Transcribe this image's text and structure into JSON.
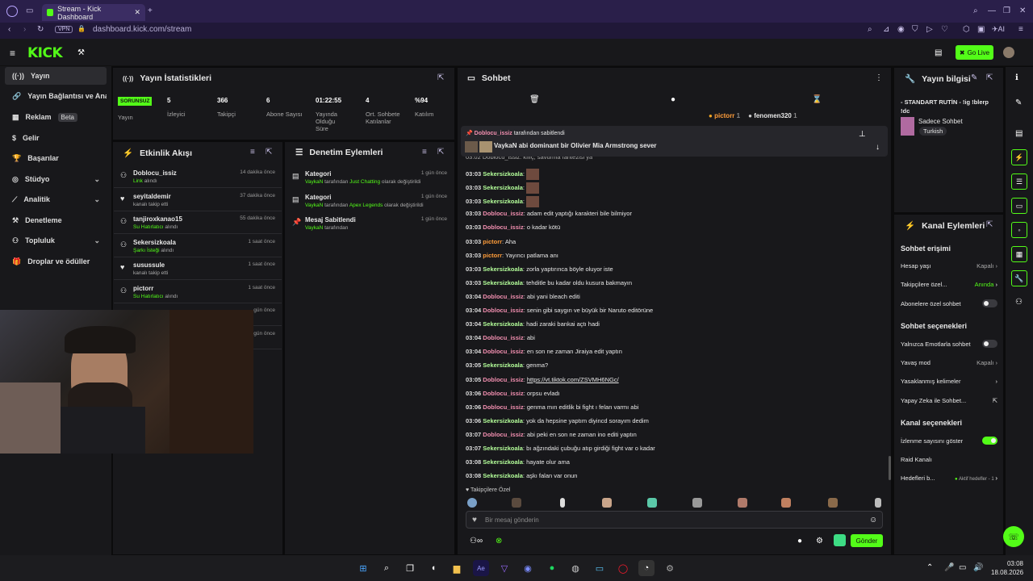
{
  "browser": {
    "tab_title": "Stream - Kick Dashboard",
    "url": "dashboard.kick.com/stream",
    "vpn": "VPN",
    "ai_label": "AI"
  },
  "topnav": {
    "logo": "KICK",
    "go_live": "Go Live"
  },
  "sidebar": {
    "items": [
      {
        "label": "Yayın",
        "icon": "broadcast-icon"
      },
      {
        "label": "Yayın Bağlantısı ve Anahtarı",
        "icon": "link-icon"
      },
      {
        "label": "Reklam",
        "icon": "ad-icon",
        "badge": "Beta"
      },
      {
        "label": "Gelir",
        "icon": "money-icon"
      },
      {
        "label": "Başarılar",
        "icon": "trophy-icon"
      },
      {
        "label": "Stüdyo",
        "icon": "studio-icon"
      },
      {
        "label": "Analitik",
        "icon": "analytics-icon"
      },
      {
        "label": "Denetleme",
        "icon": "hammer-icon"
      },
      {
        "label": "Topluluk",
        "icon": "community-icon"
      },
      {
        "label": "Droplar ve ödüller",
        "icon": "gift-icon"
      }
    ]
  },
  "stats": {
    "title": "Yayın İstatistikleri",
    "status": "SORUNSUZ",
    "status_label": "Yayın",
    "items": [
      {
        "value": "5",
        "label": "İzleyici"
      },
      {
        "value": "366",
        "label": "Takipçi"
      },
      {
        "value": "6",
        "label": "Abone Sayısı"
      },
      {
        "value": "01:22:55",
        "label": "Yayında Olduğu Süre"
      },
      {
        "value": "4",
        "label": "Ort. Sohbete Katılanlar"
      },
      {
        "value": "%94",
        "label": "Katılım"
      }
    ]
  },
  "activity": {
    "title": "Etkinlik Akışı",
    "rows": [
      {
        "name": "Doblocu_issiz",
        "hl": "Link",
        "desc": " alındı",
        "time": "14 dakika önce",
        "icon": "gift-icon"
      },
      {
        "name": "seyitaldemir",
        "hl": "",
        "desc": "kanalı takip etti",
        "time": "37 dakika önce",
        "icon": "heart-icon"
      },
      {
        "name": "tanjiroxkanao15",
        "hl": "Su Hatırlatıcı",
        "desc": " alındı",
        "time": "55 dakika önce",
        "icon": "gift-icon"
      },
      {
        "name": "Sekersizkoala",
        "hl": "Şarkı İsteği",
        "desc": " alındı",
        "time": "1 saat önce",
        "icon": "gift-icon"
      },
      {
        "name": "susussule",
        "hl": "",
        "desc": "kanalı takip etti",
        "time": "1 saat önce",
        "icon": "heart-icon"
      },
      {
        "name": "pictorr",
        "hl": "Su Hatırlatıcı",
        "desc": " alındı",
        "time": "1 saat önce",
        "icon": "gift-icon"
      },
      {
        "name": "",
        "hl": "",
        "desc": "",
        "time": "gün önce",
        "icon": ""
      },
      {
        "name": "",
        "hl": "",
        "desc": "",
        "time": "gün önce",
        "icon": ""
      }
    ]
  },
  "moderation": {
    "title": "Denetim Eylemleri",
    "rows": [
      {
        "name": "Kategori",
        "user": "VaykaN",
        "mid": " tarafından ",
        "hl": "Just Chatting",
        "end": " olarak değiştirildi",
        "time": "1 gün önce"
      },
      {
        "name": "Kategori",
        "user": "VaykaN",
        "mid": " tarafından ",
        "hl": "Apex Legends",
        "end": " olarak değiştirildi",
        "time": "1 gün önce"
      },
      {
        "name": "Mesaj Sabitlendi",
        "user": "VaykaN",
        "mid": " tarafından",
        "hl": "",
        "end": "",
        "time": "1 gün önce"
      }
    ]
  },
  "chat": {
    "title": "Sohbet",
    "top_users": [
      {
        "name": "pictorr",
        "count": "1"
      },
      {
        "name": "fenomen320",
        "count": "1"
      }
    ],
    "pinned_by": "Doblocu_issiz",
    "pinned_label": " tarafından sabitlendi",
    "pinned_message": "VaykaN abi dominant bir Olivier Mia Armstrong sever",
    "partial_line": "03:02 Doblocu_issiz: kılıç, savurma fantezisi ya",
    "messages": [
      {
        "time": "03:03",
        "user": "Sekersizkoala",
        "text": "",
        "emote": true,
        "c": "sek"
      },
      {
        "time": "03:03",
        "user": "Sekersizkoala",
        "text": "",
        "emote": true,
        "c": "sek"
      },
      {
        "time": "03:03",
        "user": "Sekersizkoala",
        "text": "",
        "emote": true,
        "c": "sek"
      },
      {
        "time": "03:03",
        "user": "Doblocu_issiz",
        "text": "adam edit yaptığı karakteri bile bilmiyor",
        "c": "dob"
      },
      {
        "time": "03:03",
        "user": "Doblocu_issiz",
        "text": "o kadar kötü",
        "c": "dob"
      },
      {
        "time": "03:03",
        "user": "pictorr",
        "text": "Aha",
        "c": "pic"
      },
      {
        "time": "03:03",
        "user": "pictorr",
        "text": "Yayıncı patlama anı",
        "c": "pic"
      },
      {
        "time": "03:03",
        "user": "Sekersizkoala",
        "text": "zorla yaptırınca böyle oluyor iste",
        "c": "sek"
      },
      {
        "time": "03:03",
        "user": "Sekersizkoala",
        "text": "tehditle bu kadar oldu kusura bakmayın",
        "c": "sek"
      },
      {
        "time": "03:04",
        "user": "Doblocu_issiz",
        "text": "abi yani bleach editi",
        "c": "dob"
      },
      {
        "time": "03:04",
        "user": "Doblocu_issiz",
        "text": "senin gibi saygın ve büyük bir Naruto editörüne",
        "c": "dob"
      },
      {
        "time": "03:04",
        "user": "Sekersizkoala",
        "text": "hadi zaraki bankai açtı hadi",
        "c": "sek"
      },
      {
        "time": "03:04",
        "user": "Doblocu_issiz",
        "text": "abi",
        "c": "dob"
      },
      {
        "time": "03:04",
        "user": "Doblocu_issiz",
        "text": "en son ne zaman Jiraiya edit yaptın",
        "c": "dob"
      },
      {
        "time": "03:05",
        "user": "Sekersizkoala",
        "text": "genma?",
        "c": "sek"
      },
      {
        "time": "03:05",
        "user": "Doblocu_issiz",
        "text": "https://vt.tiktok.com/ZSVMH6NGc/",
        "c": "dob",
        "link": true
      },
      {
        "time": "03:06",
        "user": "Doblocu_issiz",
        "text": "orpsu evladı",
        "c": "dob"
      },
      {
        "time": "03:06",
        "user": "Doblocu_issiz",
        "text": "genma mın editlik bi fight ı felan varmı abi",
        "c": "dob"
      },
      {
        "time": "03:06",
        "user": "Sekersizkoala",
        "text": "yok da hepsine yaptım diyincd sorayım dedim",
        "c": "sek"
      },
      {
        "time": "03:07",
        "user": "Doblocu_issiz",
        "text": "abi peki en son ne zaman ino editi yaptın",
        "c": "dob"
      },
      {
        "time": "03:07",
        "user": "Sekersizkoala",
        "text": "bı ağzındaki çubuğu atıp girdiği fight var o kadar",
        "c": "sek"
      },
      {
        "time": "03:08",
        "user": "Sekersizkoala",
        "text": "hayate olur ama",
        "c": "sek"
      },
      {
        "time": "03:08",
        "user": "Sekersizkoala",
        "text": "aşkı falan var onun",
        "c": "sek"
      }
    ],
    "followers_only": "Takipçilere Özel",
    "input_placeholder": "Bir mesaj gönderin",
    "send": "Gönder"
  },
  "stream_info": {
    "title": "Yayın bilgisi",
    "stream_title": "- STANDART RUTİN - !ig !blerp !dc",
    "category": "Sadece Sohbet",
    "tag": "Turkish"
  },
  "channel_actions": {
    "title": "Kanal Eylemleri",
    "sec1": "Sohbet erişimi",
    "hesap_yasi": "Hesap yaşı",
    "hesap_yasi_val": "Kapalı",
    "takipcilere": "Takipçilere özel...",
    "takipcilere_val": "Anında",
    "abonelere": "Abonelere özel sohbet",
    "sec2": "Sohbet seçenekleri",
    "emotes": "Yalnızca Emotlarla sohbet",
    "yavas": "Yavaş mod",
    "yavas_val": "Kapalı",
    "yasak": "Yasaklanmış kelimeler",
    "ai": "Yapay Zeka ile Sohbet...",
    "sec3": "Kanal seçenekleri",
    "izlenme": "İzlenme sayısını göster",
    "raid": "Raid Kanalı",
    "hedef": "Hedefleri b...",
    "hedef_val": "Aktif hedefler - 1"
  },
  "taskbar": {
    "time": "03:08",
    "date": "18.08.2026"
  },
  "colors": {
    "accent": "#53fc18",
    "panel": "#18181b",
    "bg": "#0b0b0c"
  }
}
